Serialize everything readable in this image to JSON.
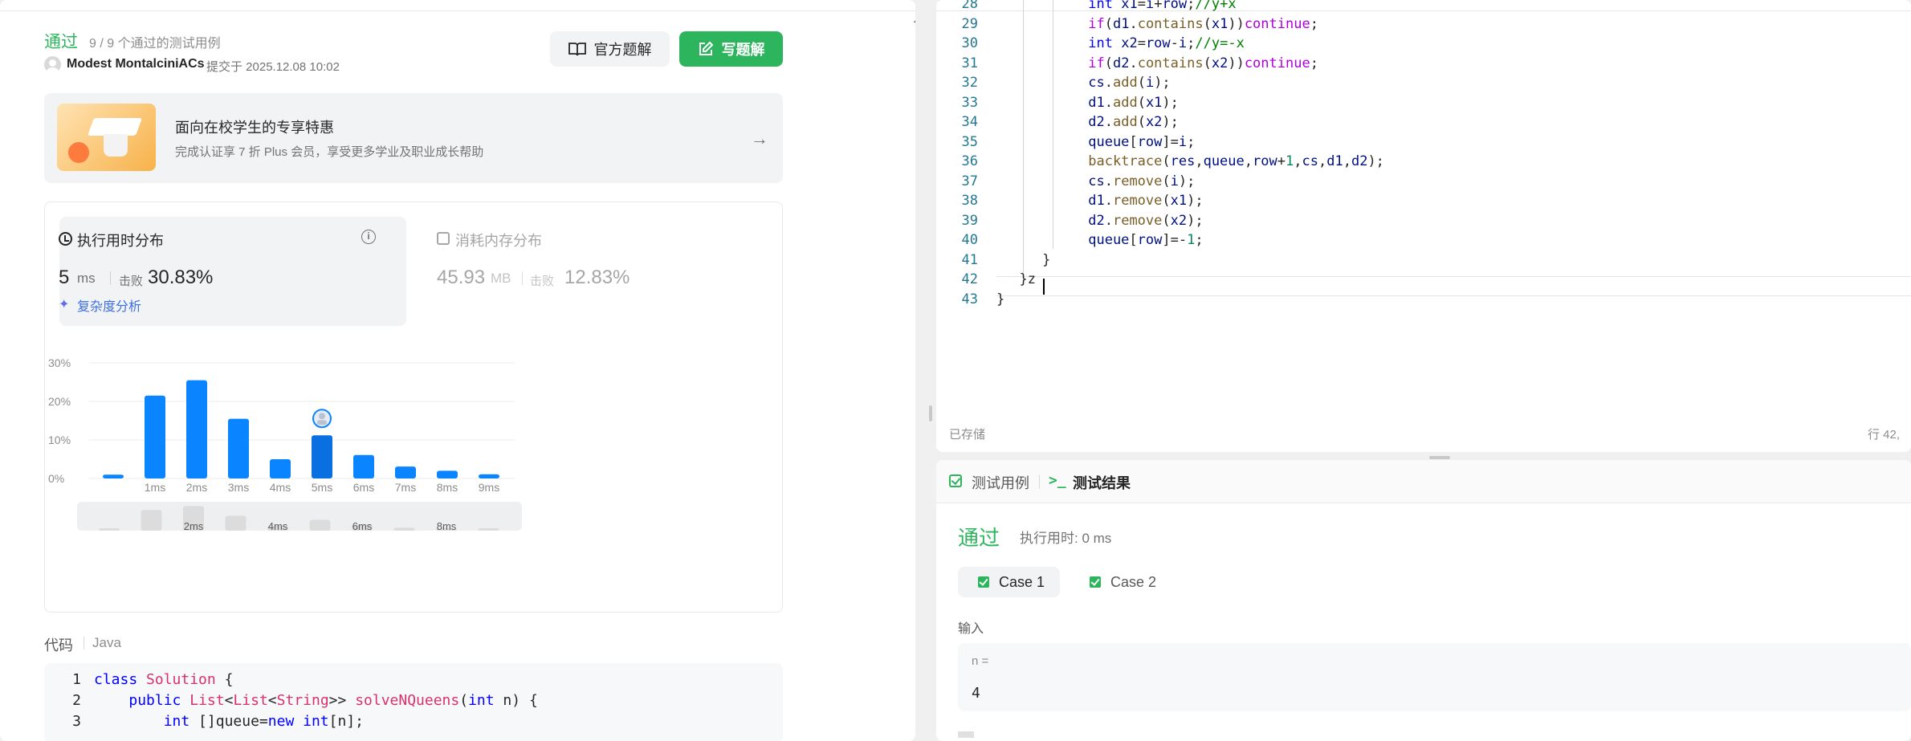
{
  "submission": {
    "status": "通过",
    "count_text": "9 / 9 个通过的测试用例",
    "username": "Modest MontalciniACs",
    "submitted_at": "提交于 2025.12.08 10:02"
  },
  "buttons": {
    "official": "官方题解",
    "write": "写题解"
  },
  "promo": {
    "title": "面向在校学生的专享特惠",
    "subtitle": "完成认证享 7 折 Plus 会员，享受更多学业及职业成长帮助"
  },
  "runtime": {
    "title": "执行用时分布",
    "value": "5",
    "unit": "ms",
    "beat_label": "击败",
    "beat_value": "30.83%",
    "complexity": "复杂度分析"
  },
  "memory": {
    "title": "消耗内存分布",
    "value": "45.93",
    "unit": "MB",
    "beat_label": "击败",
    "beat_value": "12.83%"
  },
  "chart_data": {
    "type": "bar",
    "categories": [
      "0ms",
      "1ms",
      "2ms",
      "3ms",
      "4ms",
      "5ms",
      "6ms",
      "7ms",
      "8ms",
      "9ms"
    ],
    "tick_labels": [
      "",
      "1ms",
      "2ms",
      "3ms",
      "4ms",
      "5ms",
      "6ms",
      "7ms",
      "8ms",
      "9ms"
    ],
    "values": [
      1,
      21.5,
      25.5,
      15.5,
      5,
      11.2,
      6.1,
      3.1,
      2,
      1.1
    ],
    "highlight_index": 5,
    "ylim": [
      0,
      30
    ],
    "yticks": [
      "0%",
      "10%",
      "20%",
      "30%"
    ],
    "ytick_values": [
      0,
      10,
      20,
      30
    ],
    "bar_color": "#0a84ff",
    "highlight_color": "#0a6fe0",
    "minimap_labels": [
      "",
      "",
      "2ms",
      "",
      "4ms",
      "",
      "6ms",
      "",
      "8ms",
      ""
    ],
    "grid": true
  },
  "code": {
    "label": "代码",
    "language": "Java",
    "lines": [
      {
        "n": "1",
        "text": "class Solution {"
      },
      {
        "n": "2",
        "text": "    public List<List<String>> solveNQueens(int n) {"
      },
      {
        "n": "3",
        "text": "        int []queue=new int[n];"
      }
    ]
  },
  "editor": {
    "saved": "已存储",
    "position": "行 42,",
    "lines": [
      {
        "n": "28",
        "text": "int x1=i+row;//y+x"
      },
      {
        "n": "29",
        "text": "if(d1.contains(x1))continue;"
      },
      {
        "n": "30",
        "text": "int x2=row-i;//y=-x"
      },
      {
        "n": "31",
        "text": "if(d2.contains(x2))continue;"
      },
      {
        "n": "32",
        "text": "cs.add(i);"
      },
      {
        "n": "33",
        "text": "d1.add(x1);"
      },
      {
        "n": "34",
        "text": "d2.add(x2);"
      },
      {
        "n": "35",
        "text": "queue[row]=i;"
      },
      {
        "n": "36",
        "text": "backtrace(res,queue,row+1,cs,d1,d2);"
      },
      {
        "n": "37",
        "text": "cs.remove(i);"
      },
      {
        "n": "38",
        "text": "d1.remove(x1);"
      },
      {
        "n": "39",
        "text": "d2.remove(x2);"
      },
      {
        "n": "40",
        "text": "queue[row]=-1;"
      },
      {
        "n": "41",
        "text": "}"
      },
      {
        "n": "42",
        "text": "}z"
      },
      {
        "n": "43",
        "text": "}"
      }
    ]
  },
  "results": {
    "tab_cases": "测试用例",
    "tab_result": "测试结果",
    "status": "通过",
    "runtime": "执行用时: 0 ms",
    "case1": "Case 1",
    "case2": "Case 2",
    "input_label": "输入",
    "param_name": "n =",
    "param_value": "4"
  },
  "colors": {
    "accent_green": "#2db55d",
    "link_blue": "#3b6fe8"
  }
}
